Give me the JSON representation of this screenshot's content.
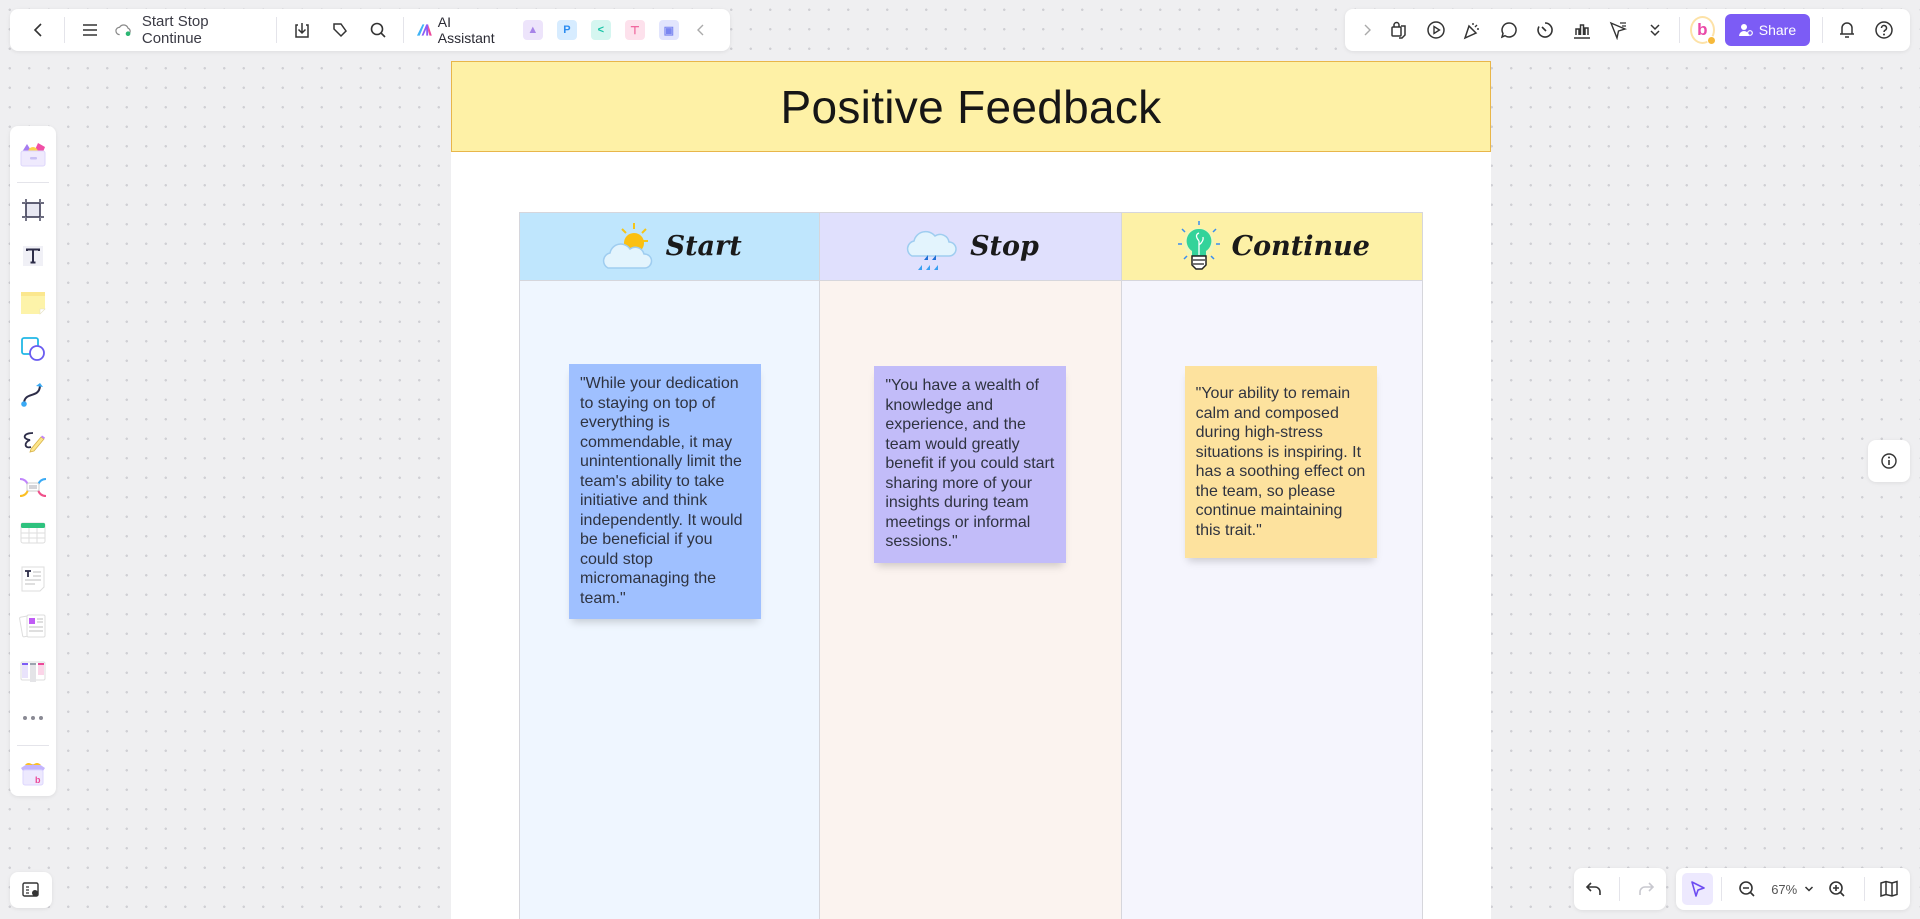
{
  "topbar_left": {
    "back_icon": "chevron-left-icon",
    "menu_icon": "hamburger-menu-icon",
    "sync_icon": "cloud-synced-icon",
    "document_title": "Start Stop Continue",
    "download_icon": "download-icon",
    "tag_icon": "tag-icon",
    "search_icon": "search-icon",
    "ai_assistant_label": "AI Assistant",
    "apps": [
      {
        "name": "image-generator-app-icon",
        "glyph": "▲",
        "bg": "#ede4fb",
        "fg": "#a783e8"
      },
      {
        "name": "presentation-app-icon",
        "glyph": "P",
        "bg": "#d7ecff",
        "fg": "#2b8cf0"
      },
      {
        "name": "mindmap-app-icon",
        "glyph": "<",
        "bg": "#d5f6f0",
        "fg": "#15c3a5"
      },
      {
        "name": "flowchart-app-icon",
        "glyph": "⊤",
        "bg": "#fde1ec",
        "fg": "#ee5b95"
      },
      {
        "name": "chat-app-icon",
        "glyph": "▣",
        "bg": "#e2e5fd",
        "fg": "#7a86f0"
      }
    ],
    "collapse_icon": "chevron-left-icon"
  },
  "topbar_right": {
    "expand_icon": "chevron-right-icon",
    "tools": [
      "lock-page-icon",
      "present-play-icon",
      "celebrate-icon",
      "comment-icon",
      "timer-icon",
      "vote-chart-icon",
      "laser-pointer-icon",
      "more-chevrons-icon"
    ],
    "avatar_letter": "b",
    "share_label": "Share",
    "notification_icon": "bell-icon",
    "help_icon": "help-icon"
  },
  "left_toolbar": {
    "tools": [
      {
        "name": "templates-tool",
        "label": "Templates"
      },
      {
        "name": "frame-tool",
        "label": "Frame"
      },
      {
        "name": "text-tool",
        "label": "Text"
      },
      {
        "name": "sticky-note-tool",
        "label": "Sticky note"
      },
      {
        "name": "shape-tool",
        "label": "Shape"
      },
      {
        "name": "connector-tool",
        "label": "Connector"
      },
      {
        "name": "pen-tool",
        "label": "Pen"
      },
      {
        "name": "mindmap-tool",
        "label": "Mind map"
      },
      {
        "name": "table-tool",
        "label": "Table"
      },
      {
        "name": "text-doc-tool",
        "label": "Document"
      },
      {
        "name": "cards-tool",
        "label": "Cards"
      },
      {
        "name": "kanban-tool",
        "label": "Kanban"
      },
      {
        "name": "more-tools",
        "label": "More"
      },
      {
        "name": "app-store-tool",
        "label": "Apps"
      }
    ]
  },
  "board": {
    "title": "Positive Feedback",
    "title_bg": "#fef1a6",
    "columns": [
      {
        "label": "Start",
        "icon": "sun-cloud-icon",
        "header_bg": "#bfe6fd",
        "body_bg": "#eff6ff",
        "note": {
          "text": "\"While your dedication to staying on top of everything is commendable, it may unintentionally limit the team's ability to take initiative and think independently. It would be beneficial if you could stop micromanaging the team.\"",
          "bg": "#9fc0ff"
        }
      },
      {
        "label": "Stop",
        "icon": "rain-cloud-icon",
        "header_bg": "#e0e0fd",
        "body_bg": "#fbf3ef",
        "note": {
          "text": "\"You have a wealth of knowledge and experience, and the team would greatly benefit if you could start sharing more of your insights during team meetings or informal sessions.\"",
          "bg": "#c2bcf9"
        }
      },
      {
        "label": "Continue",
        "icon": "lightbulb-icon",
        "header_bg": "#fdf1a6",
        "body_bg": "#f5f5fd",
        "note": {
          "text": "\"Your ability to remain calm and composed during high-stress situations is inspiring. It has a soothing effect on the team, so please continue maintaining this trait.\"",
          "bg": "#fde29e"
        }
      }
    ]
  },
  "bottom_bar": {
    "undo_icon": "undo-icon",
    "redo_icon": "redo-icon",
    "select_icon": "select-cursor-icon",
    "zoom_out_icon": "zoom-out-icon",
    "zoom_level": "67%",
    "zoom_dropdown_icon": "chevron-down-icon",
    "zoom_in_icon": "zoom-in-icon",
    "minimap_icon": "map-icon"
  },
  "side_controls": {
    "info_icon": "info-icon",
    "outline_icon": "outline-panel-icon"
  }
}
